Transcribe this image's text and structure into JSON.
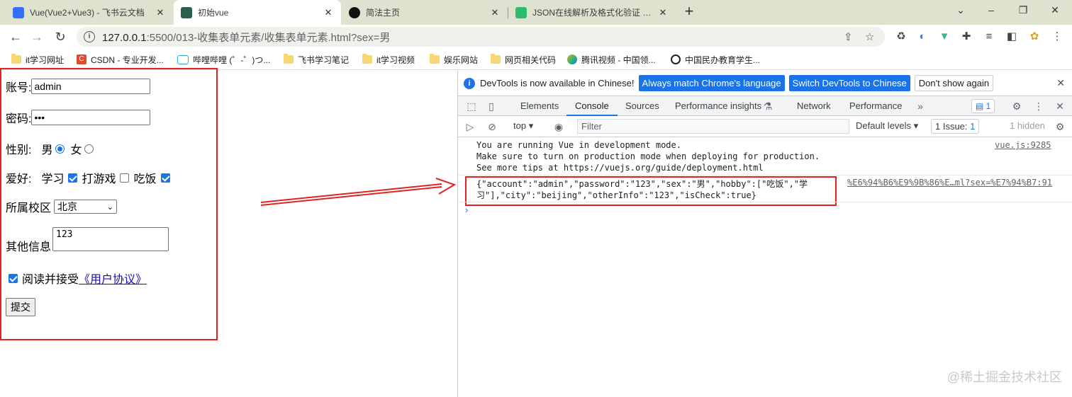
{
  "browser": {
    "tabs": [
      {
        "title": "Vue(Vue2+Vue3) - 飞书云文档",
        "color": "#3370ff"
      },
      {
        "title": "初始vue",
        "color": "#2c5f4d"
      },
      {
        "title": "简法主页",
        "color": "#111111"
      },
      {
        "title": "JSON在线解析及格式化验证 - JS",
        "color": "#2fb96b"
      }
    ],
    "new_tab": "+",
    "window_controls": {
      "minimize": "⌄",
      "restore": "–",
      "maximize": "❐",
      "close": "✕"
    },
    "nav": {
      "back": "←",
      "forward": "→",
      "reload": "↻"
    },
    "url_host": "127.0.0.1",
    "url_rest": ":5500/013-收集表单元素/收集表单元素.html?sex=男"
  },
  "bookmarks": [
    "it学习网址",
    "CSDN - 专业开发...",
    "哔哩哔哩 (゜-゜)つ...",
    "飞书学习笔记",
    "it学习视频",
    "娱乐网站",
    "网页相关代码",
    "腾讯视频 - 中国领...",
    "中国民办教育学生..."
  ],
  "form": {
    "account_label": "账号:",
    "account_value": "admin",
    "password_label": "密码:",
    "password_value": "•••",
    "sex_label": "性别:",
    "male": "男",
    "female": "女",
    "hobby_label": "爱好:",
    "hobby1": "学习",
    "hobby2": "打游戏",
    "hobby3": "吃饭",
    "campus_label": "所属校区",
    "campus_value": "北京",
    "other_label": "其他信息",
    "other_value": "123",
    "agree_text": "阅读并接受",
    "agree_link": "《用户协议》",
    "submit": "提交"
  },
  "devtools": {
    "infobar_msg": "DevTools is now available in Chinese!",
    "btn_match": "Always match Chrome's language",
    "btn_switch": "Switch DevTools to Chinese",
    "btn_dont": "Don't show again",
    "tabs": [
      "Elements",
      "Console",
      "Sources",
      "Performance insights",
      "Network",
      "Performance"
    ],
    "msg_badge": "1",
    "context": "top",
    "filter_placeholder": "Filter",
    "levels": "Default levels",
    "issues": "1 Issue:",
    "issues_count": "1",
    "hidden": "1 hidden",
    "log1_l1": "You are running Vue in development mode.",
    "log1_l2": "Make sure to turn on production mode when deploying for production.",
    "log1_l3_pre": "See more tips at ",
    "log1_l3_link": "https://vuejs.org/guide/deployment.html",
    "log1_src": "vue.js:9285",
    "log2_l1": "{\"account\":\"admin\",\"password\":\"123\",\"sex\":\"男\",\"hobby\":[\"吃饭\",\"学",
    "log2_l2": "习\"],\"city\":\"beijing\",\"otherInfo\":\"123\",\"isCheck\":true}",
    "log2_src": "%E6%94%B6%E9%9B%86%E…ml?sex=%E7%94%B7:91",
    "prompt": "›"
  },
  "watermark": "@稀土掘金技术社区"
}
